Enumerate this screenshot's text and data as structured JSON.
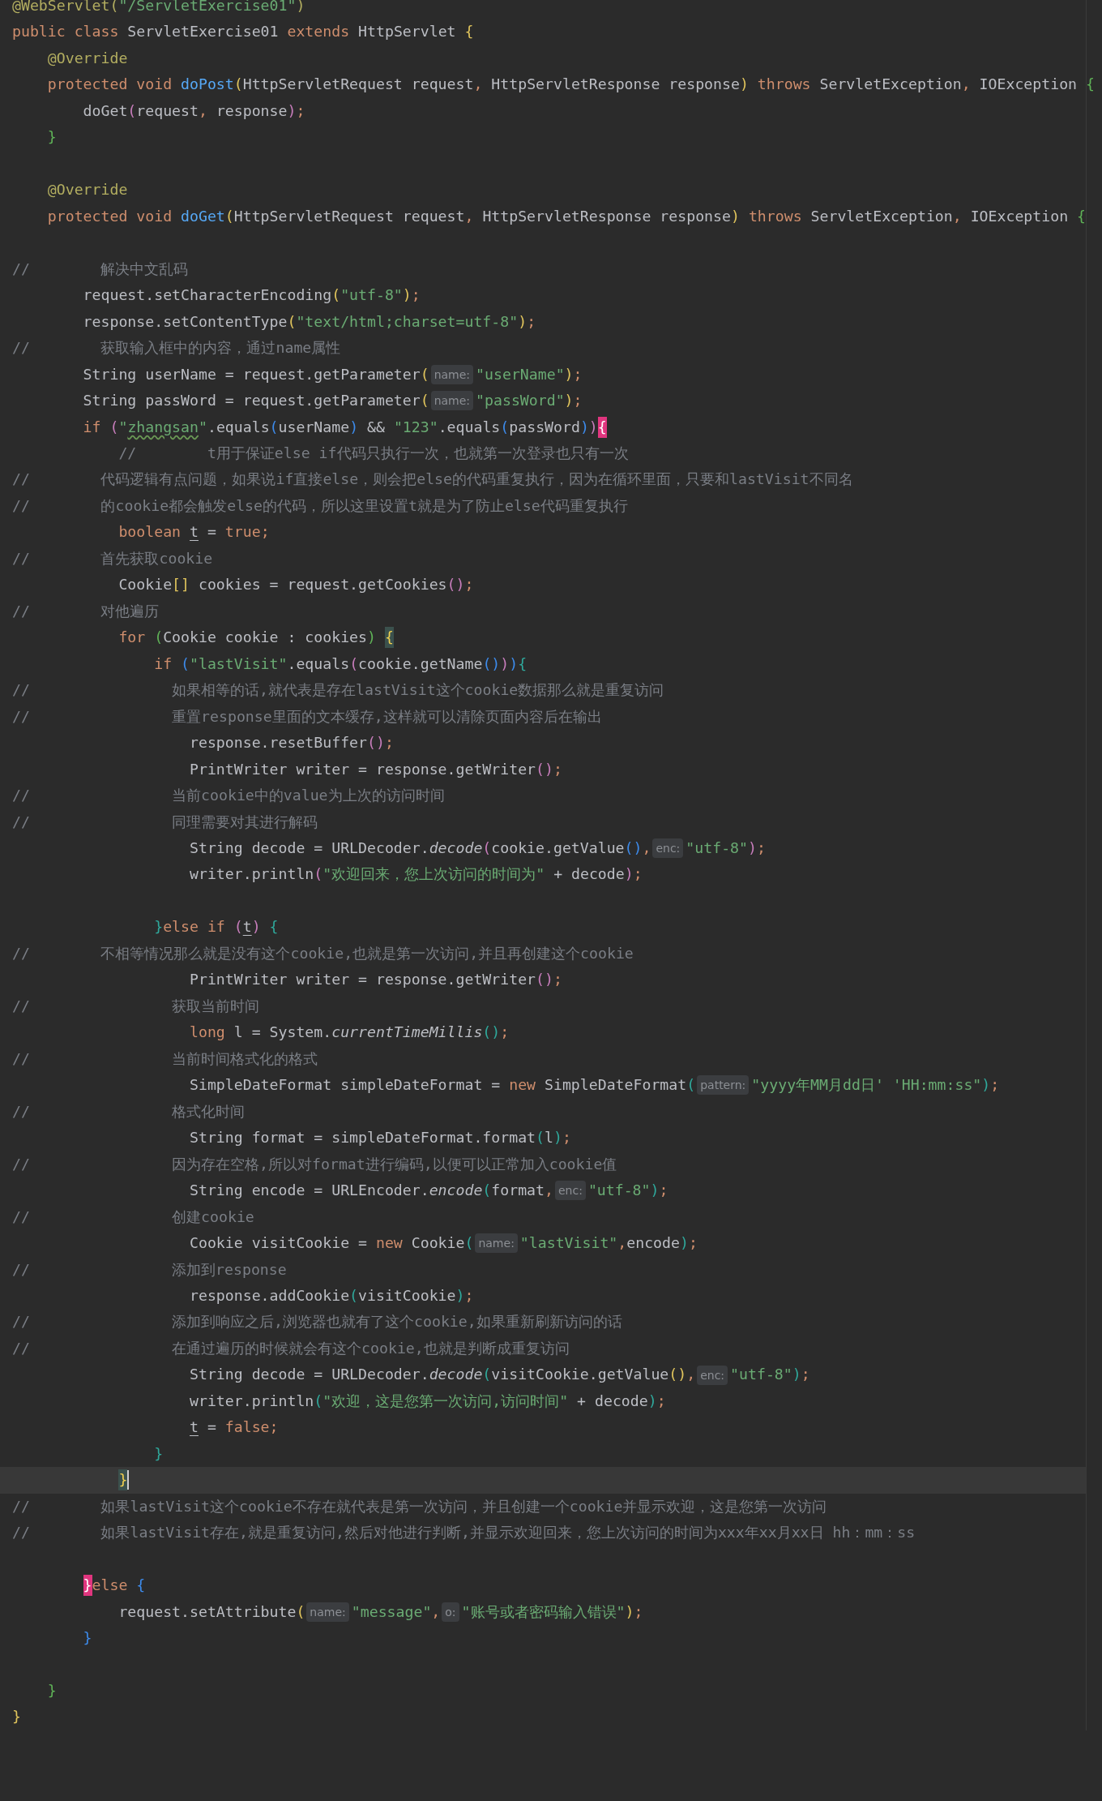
{
  "editor": {
    "lines": [
      {
        "current": false,
        "tokens": [
          {
            "kind": "ann",
            "text": "@WebServlet("
          },
          {
            "kind": "str",
            "text": "\"/ServletExercise01\""
          },
          {
            "kind": "ann",
            "text": ")"
          }
        ]
      },
      {
        "current": false,
        "tokens": [
          {
            "kind": "kw",
            "text": "public class "
          },
          {
            "kind": "plain",
            "text": "ServletExercise01 "
          },
          {
            "kind": "kw",
            "text": "extends "
          },
          {
            "kind": "plain",
            "text": "HttpServlet "
          },
          {
            "kind": "y",
            "text": "{"
          }
        ]
      },
      {
        "current": false,
        "tokens": [
          {
            "kind": "ann",
            "text": "    @Override"
          }
        ]
      },
      {
        "current": false,
        "tokens": [
          {
            "kind": "kw",
            "text": "    protected void "
          },
          {
            "kind": "decl",
            "text": "doPost"
          },
          {
            "kind": "y",
            "text": "("
          },
          {
            "kind": "plain",
            "text": "HttpServletRequest request"
          },
          {
            "kind": "kw",
            "text": ", "
          },
          {
            "kind": "plain",
            "text": "HttpServletResponse response"
          },
          {
            "kind": "y",
            "text": ")"
          },
          {
            "kind": "kw",
            "text": " throws "
          },
          {
            "kind": "plain",
            "text": "ServletException"
          },
          {
            "kind": "kw",
            "text": ", "
          },
          {
            "kind": "plain",
            "text": "IOException "
          },
          {
            "kind": "g",
            "text": "{"
          }
        ]
      },
      {
        "current": false,
        "tokens": [
          {
            "kind": "plain",
            "text": "        doGet"
          },
          {
            "kind": "p",
            "text": "("
          },
          {
            "kind": "plain",
            "text": "request"
          },
          {
            "kind": "kw",
            "text": ", "
          },
          {
            "kind": "plain",
            "text": "response"
          },
          {
            "kind": "p",
            "text": ")"
          },
          {
            "kind": "kw",
            "text": ";"
          }
        ]
      },
      {
        "current": false,
        "tokens": [
          {
            "kind": "g",
            "text": "    }"
          }
        ]
      },
      {
        "current": false
      },
      {
        "current": false,
        "tokens": [
          {
            "kind": "ann",
            "text": "    @Override"
          }
        ]
      },
      {
        "current": false,
        "tokens": [
          {
            "kind": "kw",
            "text": "    protected void "
          },
          {
            "kind": "decl",
            "text": "doGet"
          },
          {
            "kind": "y",
            "text": "("
          },
          {
            "kind": "plain",
            "text": "HttpServletRequest request"
          },
          {
            "kind": "kw",
            "text": ", "
          },
          {
            "kind": "plain",
            "text": "HttpServletResponse response"
          },
          {
            "kind": "y",
            "text": ")"
          },
          {
            "kind": "kw",
            "text": " throws "
          },
          {
            "kind": "plain",
            "text": "ServletException"
          },
          {
            "kind": "kw",
            "text": ", "
          },
          {
            "kind": "plain",
            "text": "IOException "
          },
          {
            "kind": "g",
            "text": "{"
          }
        ]
      },
      {
        "current": false
      },
      {
        "current": false,
        "tokens": [
          {
            "kind": "com",
            "text": "//        解决中文乱码"
          }
        ]
      },
      {
        "current": false,
        "tokens": [
          {
            "kind": "plain",
            "text": "        request.setCharacterEncoding"
          },
          {
            "kind": "y",
            "text": "("
          },
          {
            "kind": "str",
            "text": "\"utf-8\""
          },
          {
            "kind": "y",
            "text": ")"
          },
          {
            "kind": "kw",
            "text": ";"
          }
        ]
      },
      {
        "current": false,
        "tokens": [
          {
            "kind": "plain",
            "text": "        response.setContentType"
          },
          {
            "kind": "y",
            "text": "("
          },
          {
            "kind": "str",
            "text": "\"text/html;charset=utf-8\""
          },
          {
            "kind": "y",
            "text": ")"
          },
          {
            "kind": "kw",
            "text": ";"
          }
        ]
      },
      {
        "current": false,
        "tokens": [
          {
            "kind": "com",
            "text": "//        获取输入框中的内容，通过name属性"
          }
        ]
      },
      {
        "current": false,
        "tokens": [
          {
            "kind": "plain",
            "text": "        String userName = request.getParameter"
          },
          {
            "kind": "y",
            "text": "("
          },
          {
            "kind": "hint",
            "text": "name:"
          },
          {
            "kind": "str",
            "text": "\"userName\""
          },
          {
            "kind": "y",
            "text": ")"
          },
          {
            "kind": "kw",
            "text": ";"
          }
        ]
      },
      {
        "current": false,
        "tokens": [
          {
            "kind": "plain",
            "text": "        String passWord = request.getParameter"
          },
          {
            "kind": "y",
            "text": "("
          },
          {
            "kind": "hint",
            "text": "name:"
          },
          {
            "kind": "str",
            "text": "\"passWord\""
          },
          {
            "kind": "y",
            "text": ")"
          },
          {
            "kind": "kw",
            "text": ";"
          }
        ]
      },
      {
        "current": false,
        "tokens": [
          {
            "kind": "kw",
            "text": "        if "
          },
          {
            "kind": "p",
            "text": "("
          },
          {
            "kind": "str",
            "text": "\""
          },
          {
            "kind": "typo",
            "text": "zhangsan"
          },
          {
            "kind": "str",
            "text": "\""
          },
          {
            "kind": "plain",
            "text": ".equals"
          },
          {
            "kind": "b",
            "text": "("
          },
          {
            "kind": "plain",
            "text": "userName"
          },
          {
            "kind": "b",
            "text": ")"
          },
          {
            "kind": "plain",
            "text": " && "
          },
          {
            "kind": "str",
            "text": "\"123\""
          },
          {
            "kind": "plain",
            "text": ".equals"
          },
          {
            "kind": "b",
            "text": "("
          },
          {
            "kind": "plain",
            "text": "passWord"
          },
          {
            "kind": "b",
            "text": ")"
          },
          {
            "kind": "p",
            "text": ")"
          },
          {
            "kind": "pink",
            "text": "{"
          }
        ]
      },
      {
        "current": false,
        "tokens": [
          {
            "kind": "com",
            "text": "            //        t用于保证else if代码只执行一次，也就第一次登录也只有一次"
          }
        ]
      },
      {
        "current": false,
        "tokens": [
          {
            "kind": "com",
            "text": "//        代码逻辑有点问题，如果说if直接else，则会把else的代码重复执行，因为在循环里面，只要和lastVisit不同名"
          }
        ]
      },
      {
        "current": false,
        "tokens": [
          {
            "kind": "com",
            "text": "//        的cookie都会触发else的代码，所以这里设置t就是为了防止else代码重复执行"
          }
        ]
      },
      {
        "current": false,
        "tokens": [
          {
            "kind": "kw",
            "text": "            boolean "
          },
          {
            "kind": "ul",
            "text": "t"
          },
          {
            "kind": "plain",
            "text": " = "
          },
          {
            "kind": "kw",
            "text": "true;"
          }
        ]
      },
      {
        "current": false,
        "tokens": [
          {
            "kind": "com",
            "text": "//        首先获取cookie"
          }
        ]
      },
      {
        "current": false,
        "tokens": [
          {
            "kind": "plain",
            "text": "            Cookie"
          },
          {
            "kind": "y",
            "text": "[]"
          },
          {
            "kind": "plain",
            "text": " cookies = request.getCookies"
          },
          {
            "kind": "p",
            "text": "()"
          },
          {
            "kind": "kw",
            "text": ";"
          }
        ]
      },
      {
        "current": false,
        "tokens": [
          {
            "kind": "com",
            "text": "//        对他遍历"
          }
        ]
      },
      {
        "current": false,
        "tokens": [
          {
            "kind": "kw",
            "text": "            for "
          },
          {
            "kind": "g",
            "text": "("
          },
          {
            "kind": "plain",
            "text": "Cookie cookie : cookies"
          },
          {
            "kind": "g",
            "text": ") "
          },
          {
            "kind": "hl",
            "text": "{"
          }
        ]
      },
      {
        "current": false,
        "tokens": [
          {
            "kind": "kw",
            "text": "                if "
          },
          {
            "kind": "b",
            "text": "("
          },
          {
            "kind": "str",
            "text": "\"lastVisit\""
          },
          {
            "kind": "plain",
            "text": ".equals"
          },
          {
            "kind": "p",
            "text": "("
          },
          {
            "kind": "plain",
            "text": "cookie.getName"
          },
          {
            "kind": "b",
            "text": "()"
          },
          {
            "kind": "p",
            "text": ")"
          },
          {
            "kind": "b",
            "text": ")"
          },
          {
            "kind": "t",
            "text": "{"
          }
        ]
      },
      {
        "current": false,
        "tokens": [
          {
            "kind": "com",
            "text": "//                如果相等的话,就代表是存在lastVisit这个cookie数据那么就是重复访问"
          }
        ]
      },
      {
        "current": false,
        "tokens": [
          {
            "kind": "com",
            "text": "//                重置response里面的文本缓存,这样就可以清除页面内容后在输出"
          }
        ]
      },
      {
        "current": false,
        "tokens": [
          {
            "kind": "plain",
            "text": "                    response.resetBuffer"
          },
          {
            "kind": "p",
            "text": "()"
          },
          {
            "kind": "kw",
            "text": ";"
          }
        ]
      },
      {
        "current": false,
        "tokens": [
          {
            "kind": "plain",
            "text": "                    PrintWriter writer = response.getWriter"
          },
          {
            "kind": "p",
            "text": "()"
          },
          {
            "kind": "kw",
            "text": ";"
          }
        ]
      },
      {
        "current": false,
        "tokens": [
          {
            "kind": "com",
            "text": "//                当前cookie中的value为上次的访问时间"
          }
        ]
      },
      {
        "current": false,
        "tokens": [
          {
            "kind": "com",
            "text": "//                同理需要对其进行解码"
          }
        ]
      },
      {
        "current": false,
        "tokens": [
          {
            "kind": "plain",
            "text": "                    String decode = URLDecoder."
          },
          {
            "kind": "italic",
            "text": "decode"
          },
          {
            "kind": "p",
            "text": "("
          },
          {
            "kind": "plain",
            "text": "cookie.getValue"
          },
          {
            "kind": "b",
            "text": "()"
          },
          {
            "kind": "kw",
            "text": ","
          },
          {
            "kind": "hint",
            "text": "enc:"
          },
          {
            "kind": "str",
            "text": "\"utf-8\""
          },
          {
            "kind": "p",
            "text": ")"
          },
          {
            "kind": "kw",
            "text": ";"
          }
        ]
      },
      {
        "current": false,
        "tokens": [
          {
            "kind": "plain",
            "text": "                    writer.println"
          },
          {
            "kind": "p",
            "text": "("
          },
          {
            "kind": "str",
            "text": "\"欢迎回来，您上次访问的时间为\""
          },
          {
            "kind": "plain",
            "text": " + decode"
          },
          {
            "kind": "p",
            "text": ")"
          },
          {
            "kind": "kw",
            "text": ";"
          }
        ]
      },
      {
        "current": false
      },
      {
        "current": false,
        "tokens": [
          {
            "kind": "t",
            "text": "                }"
          },
          {
            "kind": "kw",
            "text": "else if "
          },
          {
            "kind": "p",
            "text": "("
          },
          {
            "kind": "ul",
            "text": "t"
          },
          {
            "kind": "p",
            "text": ") "
          },
          {
            "kind": "t",
            "text": "{"
          }
        ]
      },
      {
        "current": false,
        "tokens": [
          {
            "kind": "com",
            "text": "//        不相等情况那么就是没有这个cookie,也就是第一次访问,并且再创建这个cookie"
          }
        ]
      },
      {
        "current": false,
        "tokens": [
          {
            "kind": "plain",
            "text": "                    PrintWriter writer = response.getWriter"
          },
          {
            "kind": "p",
            "text": "()"
          },
          {
            "kind": "kw",
            "text": ";"
          }
        ]
      },
      {
        "current": false,
        "tokens": [
          {
            "kind": "com",
            "text": "//                获取当前时间"
          }
        ]
      },
      {
        "current": false,
        "tokens": [
          {
            "kind": "kw",
            "text": "                    long "
          },
          {
            "kind": "plain",
            "text": "l = System."
          },
          {
            "kind": "italic",
            "text": "currentTimeMillis"
          },
          {
            "kind": "t",
            "text": "()"
          },
          {
            "kind": "kw",
            "text": ";"
          }
        ]
      },
      {
        "current": false,
        "tokens": [
          {
            "kind": "com",
            "text": "//                当前时间格式化的格式"
          }
        ]
      },
      {
        "current": false,
        "tokens": [
          {
            "kind": "plain",
            "text": "                    SimpleDateFormat simpleDateFormat = "
          },
          {
            "kind": "kw",
            "text": "new "
          },
          {
            "kind": "plain",
            "text": "SimpleDateFormat"
          },
          {
            "kind": "t",
            "text": "("
          },
          {
            "kind": "hint",
            "text": "pattern:"
          },
          {
            "kind": "str",
            "text": "\"yyyy年MM月dd日' 'HH:mm:ss\""
          },
          {
            "kind": "t",
            "text": ")"
          },
          {
            "kind": "kw",
            "text": ";"
          }
        ]
      },
      {
        "current": false,
        "tokens": [
          {
            "kind": "com",
            "text": "//                格式化时间"
          }
        ]
      },
      {
        "current": false,
        "tokens": [
          {
            "kind": "plain",
            "text": "                    String format = simpleDateFormat.format"
          },
          {
            "kind": "t",
            "text": "("
          },
          {
            "kind": "plain",
            "text": "l"
          },
          {
            "kind": "t",
            "text": ")"
          },
          {
            "kind": "kw",
            "text": ";"
          }
        ]
      },
      {
        "current": false,
        "tokens": [
          {
            "kind": "com",
            "text": "//                因为存在空格,所以对format进行编码,以便可以正常加入cookie值"
          }
        ]
      },
      {
        "current": false,
        "tokens": [
          {
            "kind": "plain",
            "text": "                    String encode = URLEncoder."
          },
          {
            "kind": "italic",
            "text": "encode"
          },
          {
            "kind": "t",
            "text": "("
          },
          {
            "kind": "plain",
            "text": "format"
          },
          {
            "kind": "kw",
            "text": ","
          },
          {
            "kind": "hint",
            "text": "enc:"
          },
          {
            "kind": "str",
            "text": "\"utf-8\""
          },
          {
            "kind": "t",
            "text": ")"
          },
          {
            "kind": "kw",
            "text": ";"
          }
        ]
      },
      {
        "current": false,
        "tokens": [
          {
            "kind": "com",
            "text": "//                创建cookie"
          }
        ]
      },
      {
        "current": false,
        "tokens": [
          {
            "kind": "plain",
            "text": "                    Cookie visitCookie = "
          },
          {
            "kind": "kw",
            "text": "new "
          },
          {
            "kind": "plain",
            "text": "Cookie"
          },
          {
            "kind": "t",
            "text": "("
          },
          {
            "kind": "hint",
            "text": "name:"
          },
          {
            "kind": "str",
            "text": "\"lastVisit\""
          },
          {
            "kind": "kw",
            "text": ","
          },
          {
            "kind": "plain",
            "text": "encode"
          },
          {
            "kind": "t",
            "text": ")"
          },
          {
            "kind": "kw",
            "text": ";"
          }
        ]
      },
      {
        "current": false,
        "tokens": [
          {
            "kind": "com",
            "text": "//                添加到response"
          }
        ]
      },
      {
        "current": false,
        "tokens": [
          {
            "kind": "plain",
            "text": "                    response.addCookie"
          },
          {
            "kind": "t",
            "text": "("
          },
          {
            "kind": "plain",
            "text": "visitCookie"
          },
          {
            "kind": "t",
            "text": ")"
          },
          {
            "kind": "kw",
            "text": ";"
          }
        ]
      },
      {
        "current": false,
        "tokens": [
          {
            "kind": "com",
            "text": "//                添加到响应之后,浏览器也就有了这个cookie,如果重新刷新访问的话"
          }
        ]
      },
      {
        "current": false,
        "tokens": [
          {
            "kind": "com",
            "text": "//                在通过遍历的时候就会有这个cookie,也就是判断成重复访问"
          }
        ]
      },
      {
        "current": false,
        "tokens": [
          {
            "kind": "plain",
            "text": "                    String decode = URLDecoder."
          },
          {
            "kind": "italic",
            "text": "decode"
          },
          {
            "kind": "t",
            "text": "("
          },
          {
            "kind": "plain",
            "text": "visitCookie.getValue"
          },
          {
            "kind": "y",
            "text": "()"
          },
          {
            "kind": "kw",
            "text": ","
          },
          {
            "kind": "hint",
            "text": "enc:"
          },
          {
            "kind": "str",
            "text": "\"utf-8\""
          },
          {
            "kind": "t",
            "text": ")"
          },
          {
            "kind": "kw",
            "text": ";"
          }
        ]
      },
      {
        "current": false,
        "tokens": [
          {
            "kind": "plain",
            "text": "                    writer.println"
          },
          {
            "kind": "t",
            "text": "("
          },
          {
            "kind": "str",
            "text": "\"欢迎，这是您第一次访问,访问时间\""
          },
          {
            "kind": "plain",
            "text": " + decode"
          },
          {
            "kind": "t",
            "text": ")"
          },
          {
            "kind": "kw",
            "text": ";"
          }
        ]
      },
      {
        "current": false,
        "tokens": [
          {
            "kind": "ul",
            "text": "                    t"
          },
          {
            "kind": "plain",
            "text": " = "
          },
          {
            "kind": "kw",
            "text": "false;"
          }
        ]
      },
      {
        "current": false,
        "tokens": [
          {
            "kind": "t",
            "text": "                }"
          }
        ]
      },
      {
        "current": true,
        "tokens": [
          {
            "kind": "hl",
            "text": "            }"
          }
        ]
      },
      {
        "current": false,
        "tokens": [
          {
            "kind": "com",
            "text": "//        如果lastVisit这个cookie不存在就代表是第一次访问，并且创建一个cookie并显示欢迎，这是您第一次访问"
          }
        ]
      },
      {
        "current": false,
        "tokens": [
          {
            "kind": "com",
            "text": "//        如果lastVisit存在,就是重复访问,然后对他进行判断,并显示欢迎回来，您上次访问的时间为xxx年xx月xx日 hh：mm：ss"
          }
        ]
      },
      {
        "current": false
      },
      {
        "current": false,
        "tokens": [
          {
            "kind": "pink",
            "text": "        }"
          },
          {
            "kind": "kw",
            "text": "else "
          },
          {
            "kind": "b",
            "text": "{"
          }
        ]
      },
      {
        "current": false,
        "tokens": [
          {
            "kind": "plain",
            "text": "            request.setAttribute"
          },
          {
            "kind": "y",
            "text": "("
          },
          {
            "kind": "hint",
            "text": "name:"
          },
          {
            "kind": "str",
            "text": "\"message\""
          },
          {
            "kind": "kw",
            "text": ","
          },
          {
            "kind": "hint",
            "text": "o:"
          },
          {
            "kind": "str",
            "text": "\"账号或者密码输入错误\""
          },
          {
            "kind": "y",
            "text": ")"
          },
          {
            "kind": "kw",
            "text": ";"
          }
        ]
      },
      {
        "current": false,
        "tokens": [
          {
            "kind": "b",
            "text": "        }"
          }
        ]
      },
      {
        "current": false
      },
      {
        "current": false,
        "tokens": [
          {
            "kind": "g",
            "text": "    }"
          }
        ]
      },
      {
        "current": false,
        "tokens": [
          {
            "kind": "y",
            "text": "}"
          }
        ]
      }
    ]
  }
}
